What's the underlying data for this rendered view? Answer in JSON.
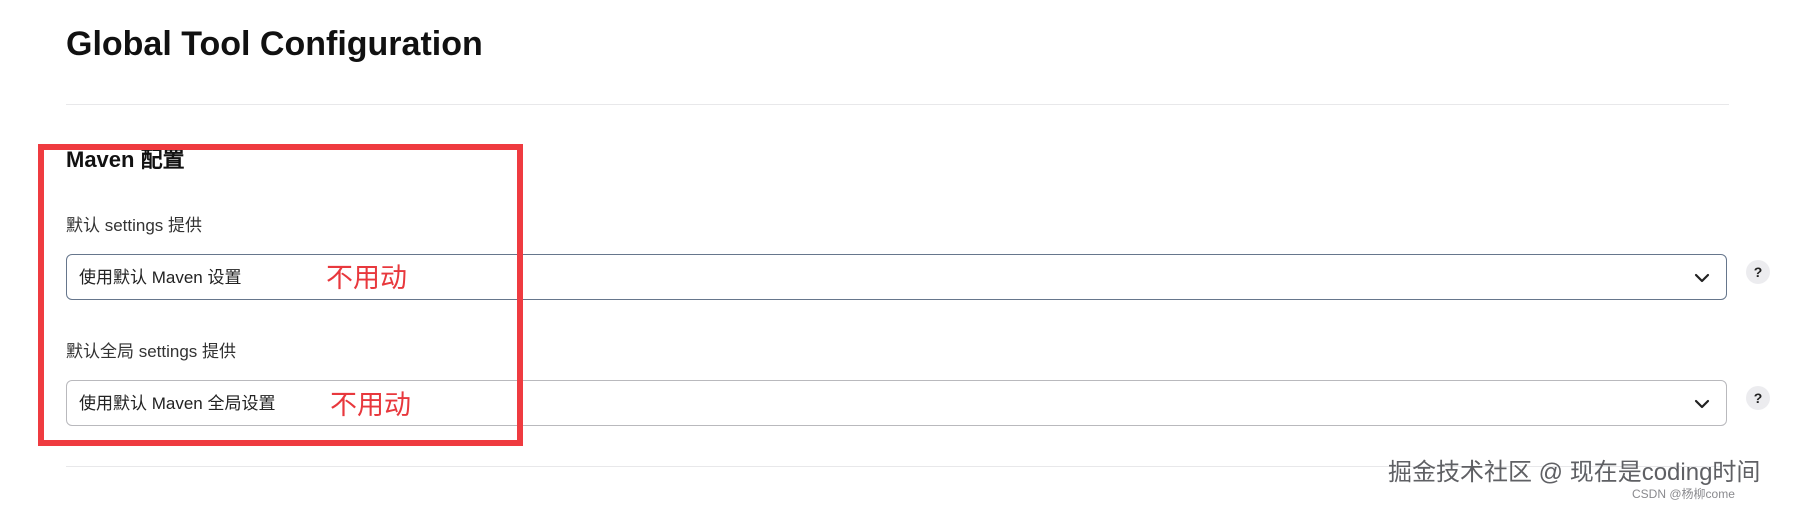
{
  "page": {
    "title": "Global Tool Configuration"
  },
  "maven_section": {
    "title": "Maven 配置",
    "settings": {
      "label": "默认 settings 提供",
      "value": "使用默认 Maven 设置",
      "help": "?",
      "annotation": "不用动"
    },
    "global_settings": {
      "label": "默认全局 settings 提供",
      "value": "使用默认 Maven 全局设置",
      "help": "?",
      "annotation": "不用动"
    }
  },
  "watermark": {
    "main": "掘金技术社区 @ 现在是coding时间",
    "small": "CSDN @杨柳come"
  },
  "colors": {
    "annotation": "#e8383d",
    "highlight_border": "#ef3b40",
    "focused_border": "#66768c"
  },
  "icons": {
    "dropdown": "chevron-down-icon",
    "help": "help-icon"
  }
}
